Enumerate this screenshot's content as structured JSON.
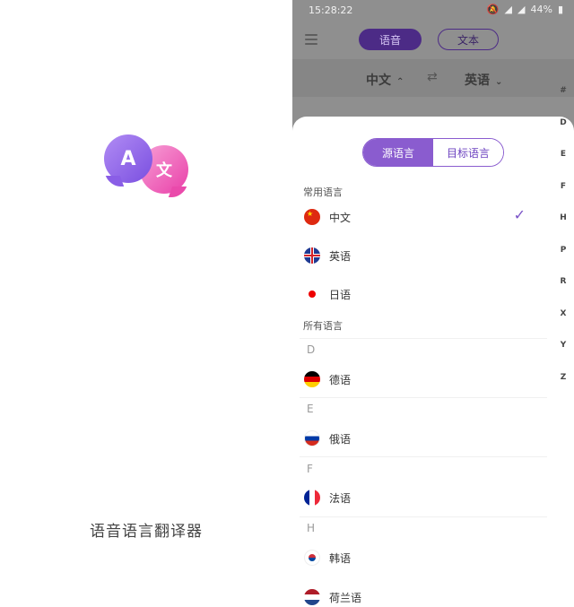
{
  "splash": {
    "logo_a": "A",
    "logo_b": "文",
    "title": "语音语言翻译器"
  },
  "status_bar": {
    "time": "15:28:22",
    "battery": "44%"
  },
  "app_bar": {
    "voice_tab": "语音",
    "text_tab": "文本"
  },
  "language_bar": {
    "from": "中文",
    "to": "英语",
    "swap": "⇄"
  },
  "sheet": {
    "tabs": {
      "source": "源语言",
      "target": "目标语言"
    },
    "common_label": "常用语言",
    "common": [
      {
        "name": "中文",
        "flag": "cn",
        "selected": true
      },
      {
        "name": "英语",
        "flag": "uk"
      },
      {
        "name": "日语",
        "flag": "jp"
      }
    ],
    "all_label": "所有语言",
    "groups": [
      {
        "letter": "D",
        "items": [
          "德语"
        ]
      },
      {
        "letter": "E",
        "items": [
          "俄语"
        ]
      },
      {
        "letter": "F",
        "items": [
          "法语"
        ]
      },
      {
        "letter": "H",
        "items": [
          "韩语",
          "荷兰语"
        ]
      }
    ],
    "index": [
      "#",
      "D",
      "E",
      "F",
      "H",
      "P",
      "R",
      "X",
      "Y",
      "Z"
    ]
  }
}
